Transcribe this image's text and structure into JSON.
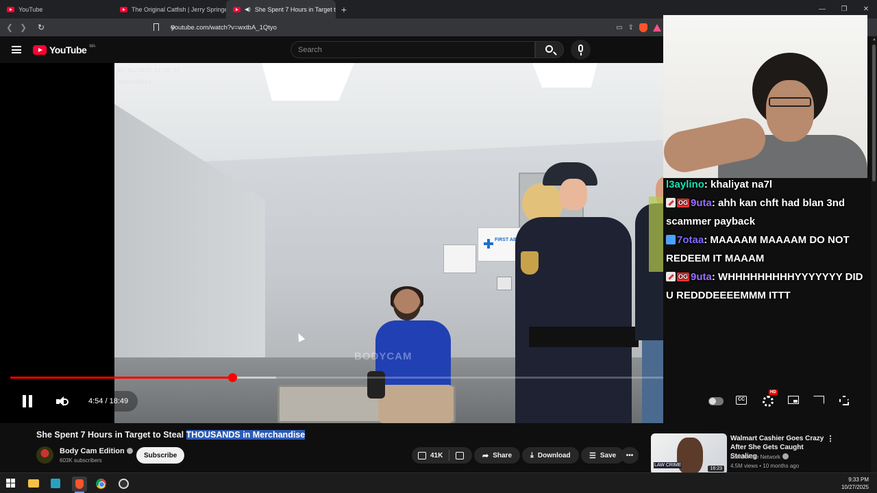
{
  "browser": {
    "tabs": [
      {
        "label": "YouTube",
        "active": false
      },
      {
        "label": "The Original Catfish | Jerry Springer",
        "active": false
      },
      {
        "label": "She Spent 7 Hours in Target t",
        "active": true
      }
    ],
    "url": "youtube.com/watch?v=wxtbA_1Qtyo"
  },
  "youtube": {
    "logo_text": "YouTube",
    "country_code": "MA",
    "search_placeholder": "Search"
  },
  "video": {
    "overlay_timestamp": "05/01/2025 13:39:17",
    "overlay_camera_id": "xpbno22@13",
    "watermark": "BODYCAM",
    "first_aid_text": "FIRST AID",
    "progress_fraction": 0.262,
    "buffered_fraction": 0.314,
    "current_time": "4:54",
    "duration": "18:49",
    "time_display": "4:54 / 18:49",
    "settings_badge": "HD",
    "cc_label": "CC"
  },
  "chat": [
    {
      "user": "l3aylino",
      "badges": [],
      "text": "khaliyat na7l",
      "color": "#1fe0b4"
    },
    {
      "user": "9uta",
      "badges": [
        "pencil",
        "OG"
      ],
      "text": "ahh kan chft had blan 3nd scammer payback",
      "color": "#9b6cff"
    },
    {
      "user": "7otaa",
      "badges": [
        "calendar"
      ],
      "text": "MAAAAM MAAAAM DO NOT REDEEM IT MAAAM",
      "color": "#7f6bff"
    },
    {
      "user": "9uta",
      "badges": [
        "pencil",
        "OG"
      ],
      "text": "WHHHHHHHHHYYYYYYY DID U REDDDEEEEMMM ITTT",
      "color": "#9b6cff"
    }
  ],
  "watch": {
    "title_plain": "She Spent 7 Hours in Target to Steal ",
    "title_highlight": "THOUSANDS in Merchandise",
    "channel_name": "Body Cam Edition",
    "subscribers": "603K subscribers",
    "subscribe_label": "Subscribe",
    "likes": "41K",
    "share_label": "Share",
    "download_label": "Download",
    "save_label": "Save",
    "more_label": "•••"
  },
  "recommended": {
    "title": "Walmart Cashier Goes Crazy After She Gets Caught Stealing",
    "channel": "Law&Crime Network",
    "meta": "4.5M views • 10 months ago",
    "duration": "16:23",
    "thumb_logo": "LAW CRIME"
  },
  "taskbar": {
    "time": "9:33 PM",
    "date": "10/27/2025"
  },
  "colors": {
    "yt_red": "#ff0033",
    "progress_red": "#ff0000",
    "highlight_blue": "#2c5bb7"
  }
}
